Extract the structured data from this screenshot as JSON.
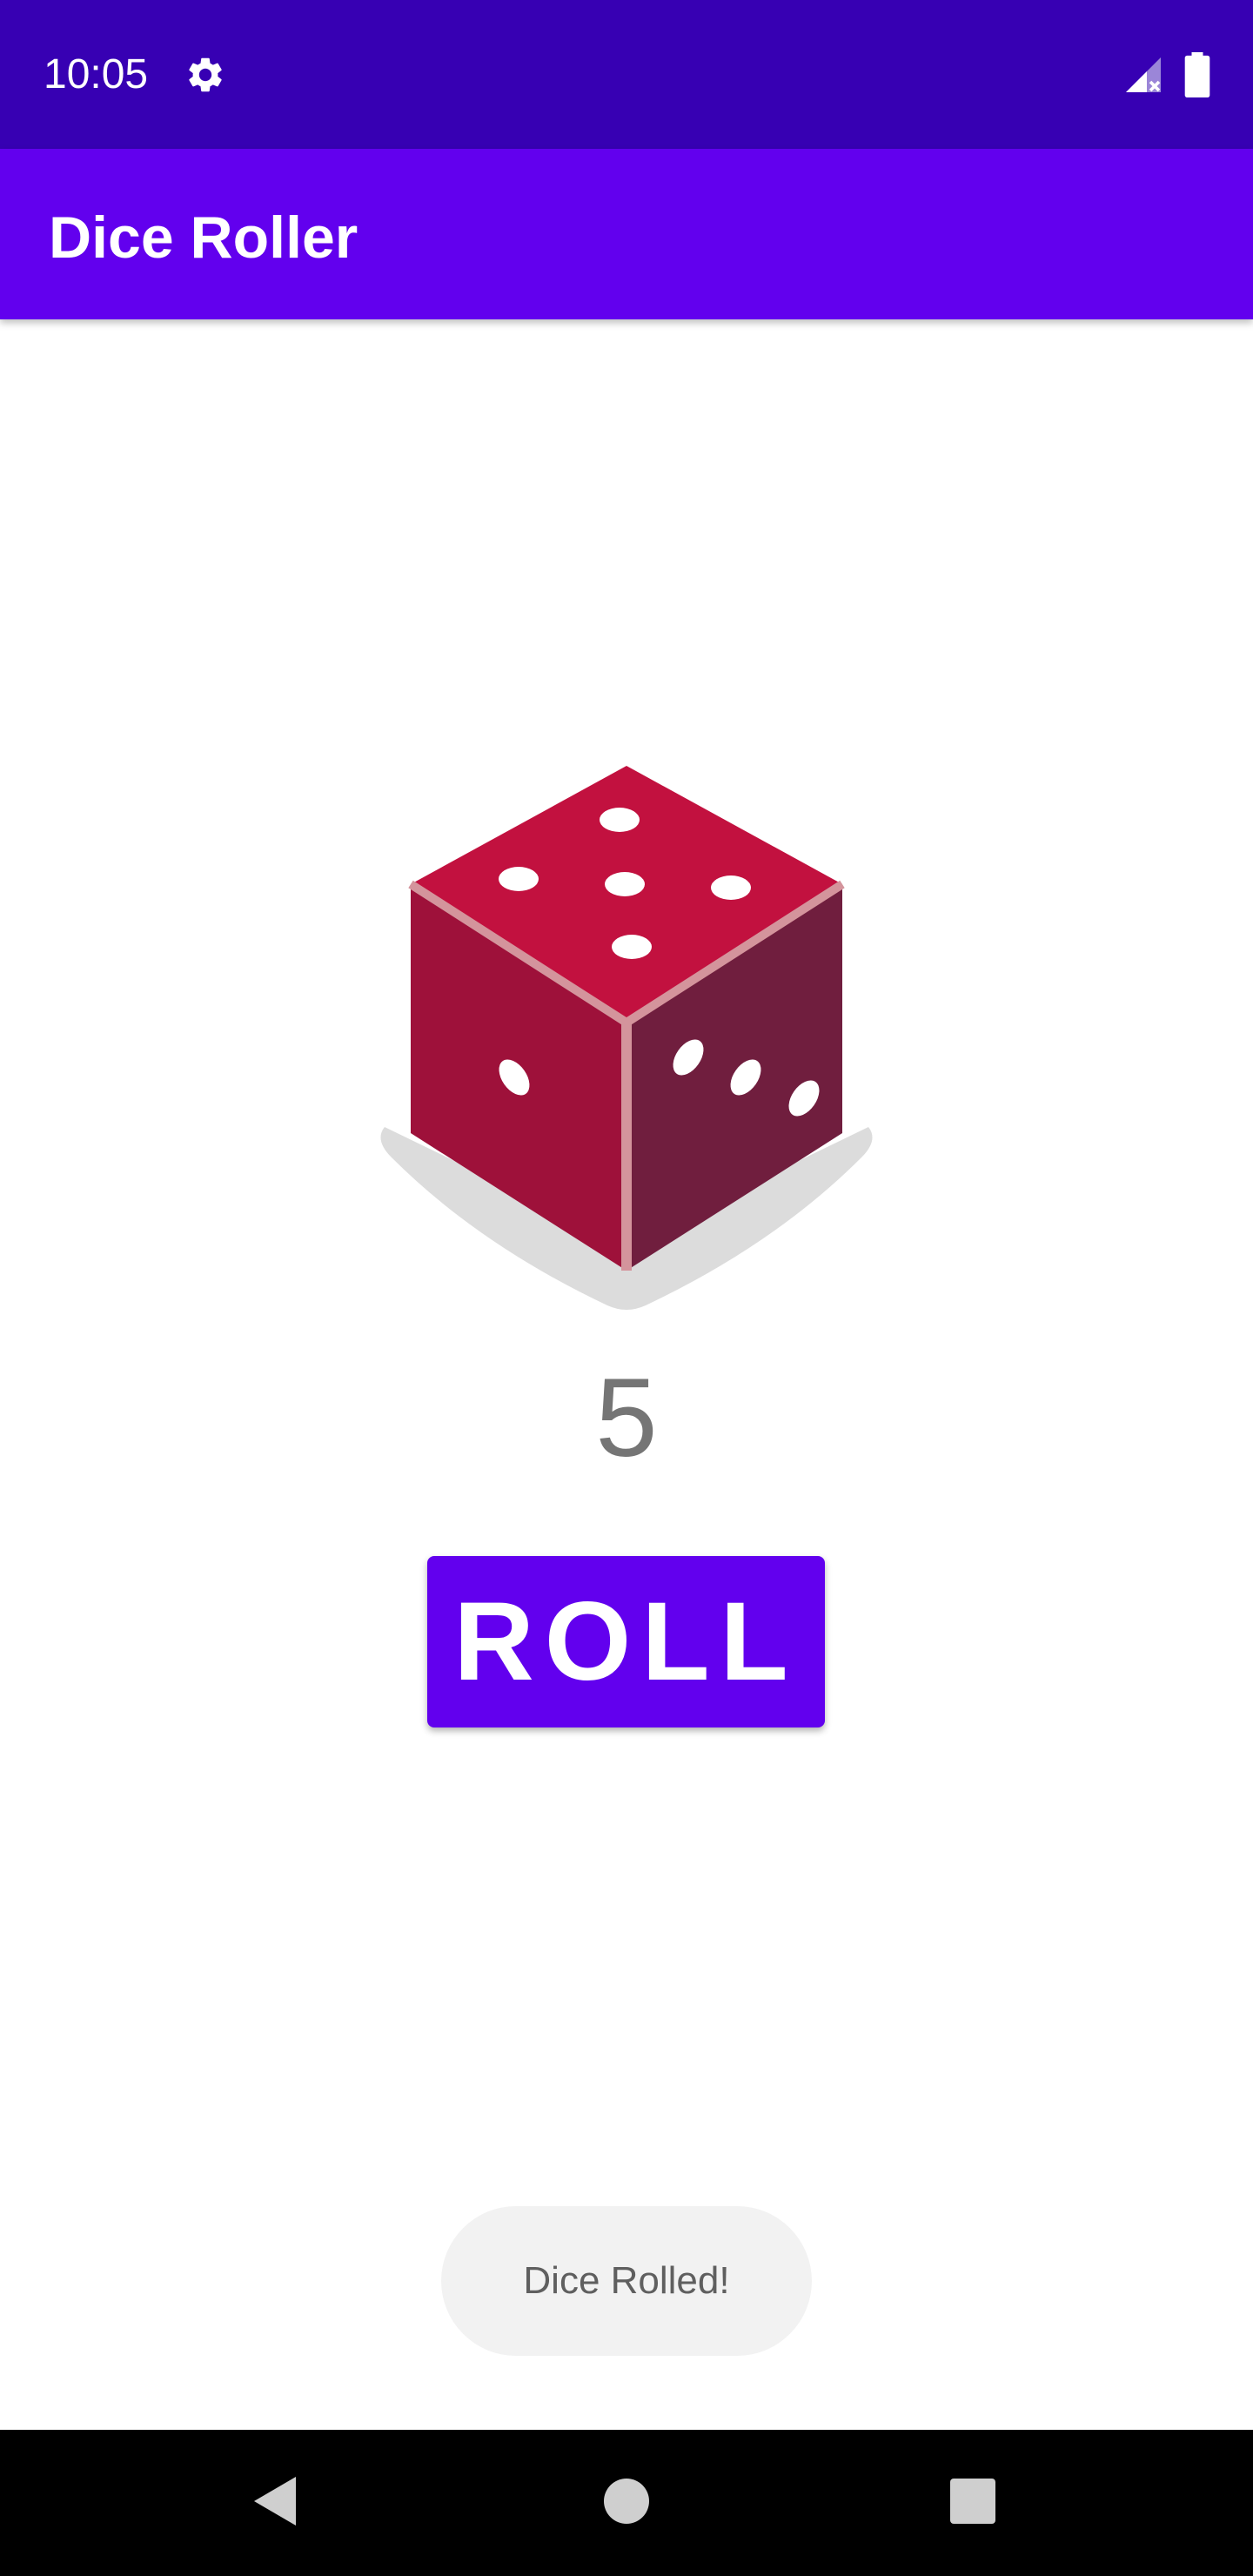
{
  "status_bar": {
    "time": "10:05",
    "icons": [
      "gear-icon",
      "signal-icon",
      "battery-icon"
    ],
    "background": "#3700b3"
  },
  "app_bar": {
    "title": "Dice Roller",
    "background": "#6200ee"
  },
  "dice": {
    "top_face_value": 5,
    "left_face_value": 1,
    "right_face_value": 3,
    "colors": {
      "top": "#c2113f",
      "left": "#9e113a",
      "right": "#701e3e",
      "edge": "#d4949c"
    }
  },
  "result": {
    "value": "5"
  },
  "roll_button": {
    "label": "ROLL",
    "background": "#6200ee"
  },
  "toast": {
    "message": "Dice Rolled!"
  },
  "nav_bar": {
    "icons": [
      "back-icon",
      "home-icon",
      "recents-icon"
    ]
  }
}
